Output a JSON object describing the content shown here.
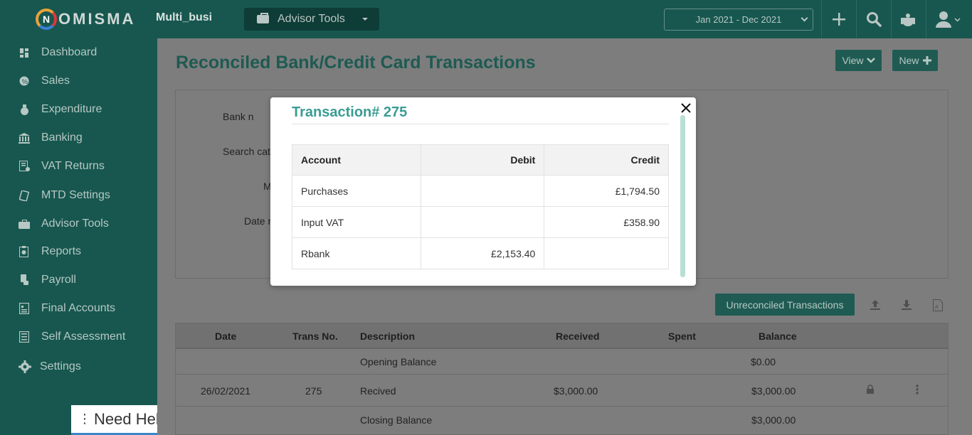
{
  "app": {
    "logo_letter": "N",
    "logo_text": "OMISMA",
    "company": "Multi_busi"
  },
  "topbar": {
    "advisor_tools": "Advisor Tools",
    "date_range": "Jan 2021 - Dec 2021",
    "icons": [
      "plus-icon",
      "search-icon",
      "crest-icon",
      "user-icon"
    ]
  },
  "sidebar": {
    "items": [
      {
        "label": "Dashboard",
        "icon": "dashboard-icon"
      },
      {
        "label": "Sales",
        "icon": "sales-icon"
      },
      {
        "label": "Expenditure",
        "icon": "money-bag-icon"
      },
      {
        "label": "Banking",
        "icon": "bank-icon"
      },
      {
        "label": "VAT Returns",
        "icon": "vat-icon"
      },
      {
        "label": "MTD Settings",
        "icon": "mtd-icon"
      },
      {
        "label": "Advisor Tools",
        "icon": "briefcase-icon"
      },
      {
        "label": "Reports",
        "icon": "reports-icon"
      },
      {
        "label": "Payroll",
        "icon": "payroll-icon"
      },
      {
        "label": "Final Accounts",
        "icon": "final-accounts-icon"
      },
      {
        "label": "Self Assessment",
        "icon": "self-assessment-icon"
      },
      {
        "label": "Settings",
        "icon": "gear-icon"
      }
    ],
    "need_help": "Need Help?"
  },
  "main": {
    "title": "Reconciled Bank/Credit Card Transactions",
    "view_btn": "View",
    "new_btn": "New",
    "filters": {
      "bank": "Bank n",
      "search": "Search cate",
      "m": "M",
      "date": "Date r"
    },
    "unreconciled_btn": "Unreconciled Transactions",
    "table": {
      "headers": {
        "date": "Date",
        "trans_no": "Trans No.",
        "description": "Description",
        "received": "Received",
        "spent": "Spent",
        "balance": "Balance"
      },
      "rows": [
        {
          "date": "",
          "trans_no": "",
          "description": "Opening Balance",
          "received": "",
          "spent": "",
          "balance": "$0.00"
        },
        {
          "date": "26/02/2021",
          "trans_no": "275",
          "description": "Recived",
          "received": "$3,000.00",
          "spent": "",
          "balance": "$3,000.00"
        },
        {
          "date": "",
          "trans_no": "",
          "description": "Closing Balance",
          "received": "",
          "spent": "",
          "balance": "$3,000.00"
        }
      ]
    }
  },
  "modal": {
    "title": "Transaction# 275",
    "headers": {
      "account": "Account",
      "debit": "Debit",
      "credit": "Credit"
    },
    "rows": [
      {
        "account": "Purchases",
        "debit": "",
        "credit": "£1,794.50"
      },
      {
        "account": "Input VAT",
        "debit": "",
        "credit": "£358.90"
      },
      {
        "account": "Rbank",
        "debit": "£2,153.40",
        "credit": ""
      }
    ]
  },
  "colors": {
    "brand": "#17574f",
    "accent": "#3a9c93",
    "title": "#1e5a52"
  }
}
